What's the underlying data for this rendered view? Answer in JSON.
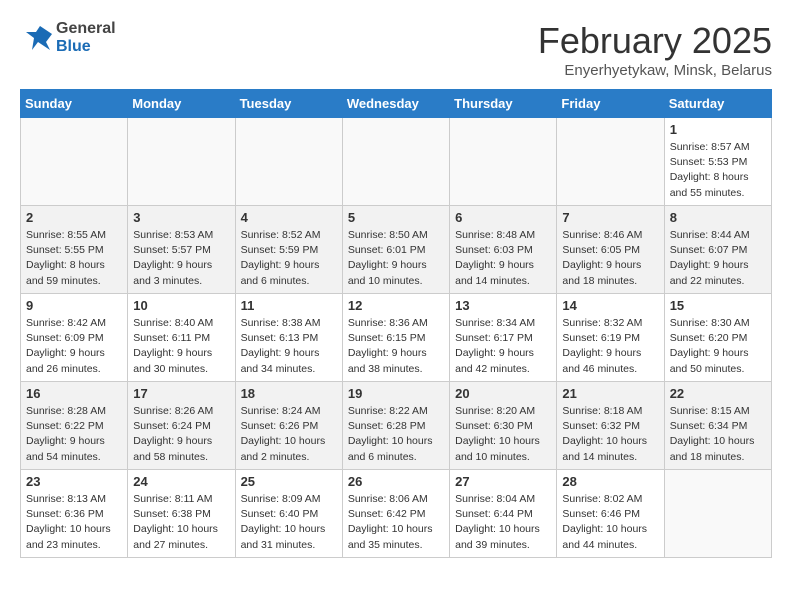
{
  "header": {
    "logo_general": "General",
    "logo_blue": "Blue",
    "month_year": "February 2025",
    "location": "Enyerhyetykaw, Minsk, Belarus"
  },
  "weekdays": [
    "Sunday",
    "Monday",
    "Tuesday",
    "Wednesday",
    "Thursday",
    "Friday",
    "Saturday"
  ],
  "weeks": [
    [
      {
        "day": "",
        "info": ""
      },
      {
        "day": "",
        "info": ""
      },
      {
        "day": "",
        "info": ""
      },
      {
        "day": "",
        "info": ""
      },
      {
        "day": "",
        "info": ""
      },
      {
        "day": "",
        "info": ""
      },
      {
        "day": "1",
        "info": "Sunrise: 8:57 AM\nSunset: 5:53 PM\nDaylight: 8 hours\nand 55 minutes."
      }
    ],
    [
      {
        "day": "2",
        "info": "Sunrise: 8:55 AM\nSunset: 5:55 PM\nDaylight: 8 hours\nand 59 minutes."
      },
      {
        "day": "3",
        "info": "Sunrise: 8:53 AM\nSunset: 5:57 PM\nDaylight: 9 hours\nand 3 minutes."
      },
      {
        "day": "4",
        "info": "Sunrise: 8:52 AM\nSunset: 5:59 PM\nDaylight: 9 hours\nand 6 minutes."
      },
      {
        "day": "5",
        "info": "Sunrise: 8:50 AM\nSunset: 6:01 PM\nDaylight: 9 hours\nand 10 minutes."
      },
      {
        "day": "6",
        "info": "Sunrise: 8:48 AM\nSunset: 6:03 PM\nDaylight: 9 hours\nand 14 minutes."
      },
      {
        "day": "7",
        "info": "Sunrise: 8:46 AM\nSunset: 6:05 PM\nDaylight: 9 hours\nand 18 minutes."
      },
      {
        "day": "8",
        "info": "Sunrise: 8:44 AM\nSunset: 6:07 PM\nDaylight: 9 hours\nand 22 minutes."
      }
    ],
    [
      {
        "day": "9",
        "info": "Sunrise: 8:42 AM\nSunset: 6:09 PM\nDaylight: 9 hours\nand 26 minutes."
      },
      {
        "day": "10",
        "info": "Sunrise: 8:40 AM\nSunset: 6:11 PM\nDaylight: 9 hours\nand 30 minutes."
      },
      {
        "day": "11",
        "info": "Sunrise: 8:38 AM\nSunset: 6:13 PM\nDaylight: 9 hours\nand 34 minutes."
      },
      {
        "day": "12",
        "info": "Sunrise: 8:36 AM\nSunset: 6:15 PM\nDaylight: 9 hours\nand 38 minutes."
      },
      {
        "day": "13",
        "info": "Sunrise: 8:34 AM\nSunset: 6:17 PM\nDaylight: 9 hours\nand 42 minutes."
      },
      {
        "day": "14",
        "info": "Sunrise: 8:32 AM\nSunset: 6:19 PM\nDaylight: 9 hours\nand 46 minutes."
      },
      {
        "day": "15",
        "info": "Sunrise: 8:30 AM\nSunset: 6:20 PM\nDaylight: 9 hours\nand 50 minutes."
      }
    ],
    [
      {
        "day": "16",
        "info": "Sunrise: 8:28 AM\nSunset: 6:22 PM\nDaylight: 9 hours\nand 54 minutes."
      },
      {
        "day": "17",
        "info": "Sunrise: 8:26 AM\nSunset: 6:24 PM\nDaylight: 9 hours\nand 58 minutes."
      },
      {
        "day": "18",
        "info": "Sunrise: 8:24 AM\nSunset: 6:26 PM\nDaylight: 10 hours\nand 2 minutes."
      },
      {
        "day": "19",
        "info": "Sunrise: 8:22 AM\nSunset: 6:28 PM\nDaylight: 10 hours\nand 6 minutes."
      },
      {
        "day": "20",
        "info": "Sunrise: 8:20 AM\nSunset: 6:30 PM\nDaylight: 10 hours\nand 10 minutes."
      },
      {
        "day": "21",
        "info": "Sunrise: 8:18 AM\nSunset: 6:32 PM\nDaylight: 10 hours\nand 14 minutes."
      },
      {
        "day": "22",
        "info": "Sunrise: 8:15 AM\nSunset: 6:34 PM\nDaylight: 10 hours\nand 18 minutes."
      }
    ],
    [
      {
        "day": "23",
        "info": "Sunrise: 8:13 AM\nSunset: 6:36 PM\nDaylight: 10 hours\nand 23 minutes."
      },
      {
        "day": "24",
        "info": "Sunrise: 8:11 AM\nSunset: 6:38 PM\nDaylight: 10 hours\nand 27 minutes."
      },
      {
        "day": "25",
        "info": "Sunrise: 8:09 AM\nSunset: 6:40 PM\nDaylight: 10 hours\nand 31 minutes."
      },
      {
        "day": "26",
        "info": "Sunrise: 8:06 AM\nSunset: 6:42 PM\nDaylight: 10 hours\nand 35 minutes."
      },
      {
        "day": "27",
        "info": "Sunrise: 8:04 AM\nSunset: 6:44 PM\nDaylight: 10 hours\nand 39 minutes."
      },
      {
        "day": "28",
        "info": "Sunrise: 8:02 AM\nSunset: 6:46 PM\nDaylight: 10 hours\nand 44 minutes."
      },
      {
        "day": "",
        "info": ""
      }
    ]
  ]
}
